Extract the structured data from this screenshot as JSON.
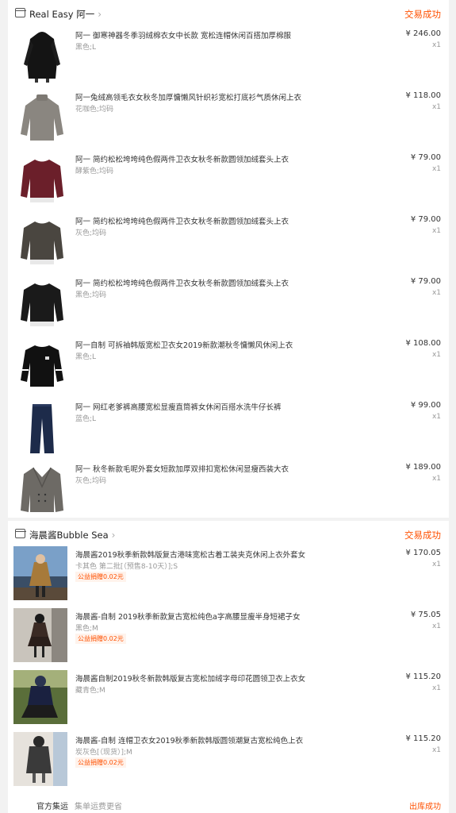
{
  "orders": [
    {
      "shop_name": "Real Easy 阿一",
      "status": "交易成功",
      "items": [
        {
          "title": "阿一 御寒神器冬季羽绒棉衣女中长款 宽松连帽休闲百搭加厚棉服",
          "sku": "黑色;L",
          "price": "¥ 246.00",
          "qty": "x1",
          "thumb": "black-coat"
        },
        {
          "title": "阿一兔绒高领毛衣女秋冬加厚慵懒风针织衫宽松打底衫气质休闲上衣",
          "sku": "花咖色;均码",
          "price": "¥ 118.00",
          "qty": "x1",
          "thumb": "grey-sweater"
        },
        {
          "title": "阿一 简约松松垮垮纯色假两件卫衣女秋冬新款圆领加绒套头上衣",
          "sku": "酵紫色;均码",
          "price": "¥ 79.00",
          "qty": "x1",
          "thumb": "burgundy-sweatshirt"
        },
        {
          "title": "阿一 简约松松垮垮纯色假两件卫衣女秋冬新款圆领加绒套头上衣",
          "sku": "灰色;均码",
          "price": "¥ 79.00",
          "qty": "x1",
          "thumb": "grey-sweatshirt"
        },
        {
          "title": "阿一 简约松松垮垮纯色假两件卫衣女秋冬新款圆领加绒套头上衣",
          "sku": "黑色;均码",
          "price": "¥ 79.00",
          "qty": "x1",
          "thumb": "black-sweatshirt"
        },
        {
          "title": "阿一自制 可拆袖韩版宽松卫衣女2019新款潮秋冬慵懒风休闲上衣",
          "sku": "黑色;L",
          "price": "¥ 108.00",
          "qty": "x1",
          "thumb": "black-detachable"
        },
        {
          "title": "阿一 网红老爹裤高腰宽松显瘦直筒裤女休闲百搭水洗牛仔长裤",
          "sku": "蓝色;L",
          "price": "¥ 99.00",
          "qty": "x1",
          "thumb": "jeans"
        },
        {
          "title": "阿一 秋冬新款毛呢外套女短款加厚双排扣宽松休闲显瘦西装大衣",
          "sku": "灰色;均码",
          "price": "¥ 189.00",
          "qty": "x1",
          "thumb": "grey-blazer"
        }
      ]
    },
    {
      "shop_name": "海晨酱Bubble Sea",
      "status": "交易成功",
      "items": [
        {
          "title": "海晨酱2019秋季新款韩版复古港味宽松古着工装夹克休闲上衣外套女",
          "sku": "卡其色 第二批[（预售8-10天）];S",
          "tag": "公益捐赠0.02元",
          "price": "¥ 170.05",
          "qty": "x1",
          "thumb": "photo-khaki"
        },
        {
          "title": "海晨酱-自制 2019秋季新款复古宽松纯色a字高腰显瘦半身短裙子女",
          "sku": "黑色;M",
          "tag": "公益捐赠0.02元",
          "price": "¥ 75.05",
          "qty": "x1",
          "thumb": "photo-skirt"
        },
        {
          "title": "海晨酱自制2019秋冬新款韩版复古宽松加绒字母印花圆领卫衣上衣女",
          "sku": "藏青色;M",
          "tag": "",
          "price": "¥ 115.20",
          "qty": "x1",
          "thumb": "photo-navy"
        },
        {
          "title": "海晨酱-自制 连帽卫衣女2019秋季新款韩版圆领潮复古宽松纯色上衣",
          "sku": "炭灰色[（现货）];M",
          "tag": "公益捐赠0.02元",
          "price": "¥ 115.20",
          "qty": "x1",
          "thumb": "photo-grey"
        }
      ],
      "footer": {
        "label": "官方集运",
        "desc": "集单运费更省",
        "status": "出库成功"
      }
    }
  ],
  "colors": {
    "accent": "#ff5000",
    "muted": "#999999",
    "text": "#333333"
  }
}
